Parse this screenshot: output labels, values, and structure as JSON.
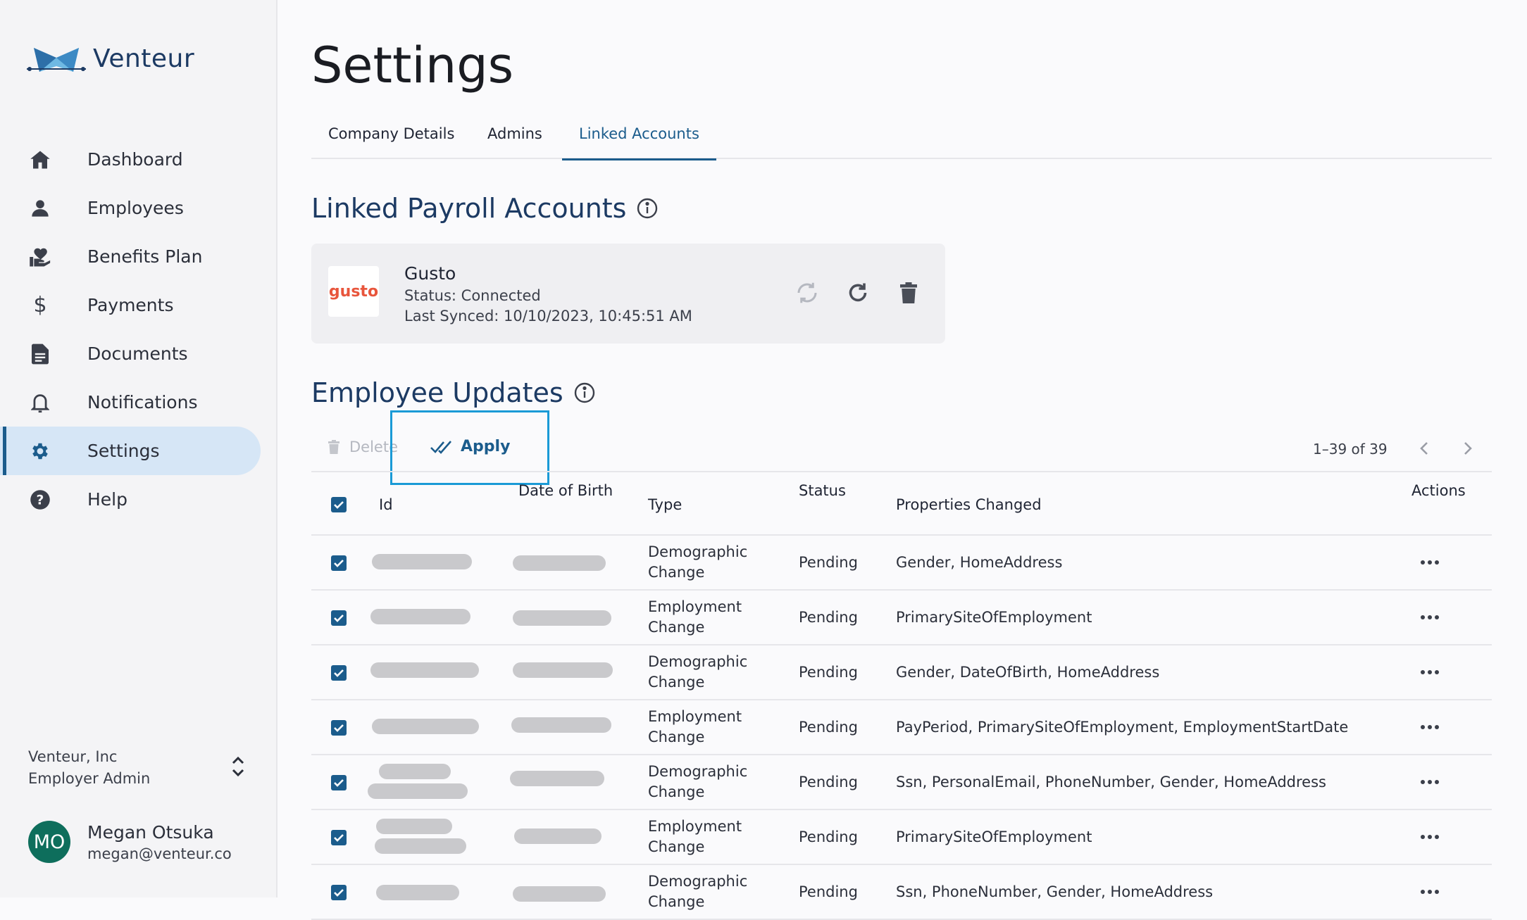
{
  "app": {
    "name": "Venteur"
  },
  "sidebar": {
    "items": [
      {
        "label": "Dashboard",
        "icon": "home-icon"
      },
      {
        "label": "Employees",
        "icon": "person-icon"
      },
      {
        "label": "Benefits Plan",
        "icon": "benefits-icon"
      },
      {
        "label": "Payments",
        "icon": "dollar-icon"
      },
      {
        "label": "Documents",
        "icon": "document-icon"
      },
      {
        "label": "Notifications",
        "icon": "bell-icon"
      },
      {
        "label": "Settings",
        "icon": "gear-icon",
        "active": true
      },
      {
        "label": "Help",
        "icon": "help-icon"
      }
    ],
    "org": {
      "name": "Venteur, Inc",
      "role": "Employer Admin"
    },
    "user": {
      "initials": "MO",
      "name": "Megan Otsuka",
      "email": "megan@venteur.co"
    }
  },
  "page": {
    "title": "Settings",
    "tabs": [
      {
        "label": "Company Details"
      },
      {
        "label": "Admins"
      },
      {
        "label": "Linked Accounts",
        "active": true
      }
    ]
  },
  "linked_payroll": {
    "title": "Linked Payroll Accounts",
    "account": {
      "logo_text": "gusto",
      "name": "Gusto",
      "status": "Status: Connected",
      "last_synced": "Last Synced: 10/10/2023, 10:45:51 AM"
    }
  },
  "employee_updates": {
    "title": "Employee Updates",
    "toolbar": {
      "delete_label": "Delete",
      "apply_label": "Apply"
    },
    "pagination": {
      "range": "1–39 of 39"
    },
    "columns": {
      "id": "Id",
      "dob": "Date of Birth",
      "type": "Type",
      "status": "Status",
      "props": "Properties Changed",
      "actions": "Actions"
    },
    "rows": [
      {
        "type1": "Demographic",
        "type2": "Change",
        "status": "Pending",
        "props": "Gender, HomeAddress"
      },
      {
        "type1": "Employment",
        "type2": "Change",
        "status": "Pending",
        "props": "PrimarySiteOfEmployment"
      },
      {
        "type1": "Demographic",
        "type2": "Change",
        "status": "Pending",
        "props": "Gender, DateOfBirth, HomeAddress"
      },
      {
        "type1": "Employment",
        "type2": "Change",
        "status": "Pending",
        "props": "PayPeriod, PrimarySiteOfEmployment, EmploymentStartDate"
      },
      {
        "type1": "Demographic",
        "type2": "Change",
        "status": "Pending",
        "props": "Ssn, PersonalEmail, PhoneNumber, Gender, HomeAddress"
      },
      {
        "type1": "Employment",
        "type2": "Change",
        "status": "Pending",
        "props": "PrimarySiteOfEmployment"
      },
      {
        "type1": "Demographic",
        "type2": "Change",
        "status": "Pending",
        "props": "Ssn, PhoneNumber, Gender, HomeAddress"
      }
    ]
  },
  "colors": {
    "accent": "#1b5c8c",
    "brand_navy": "#1c3a63",
    "highlight": "#1a9ad6",
    "gusto": "#e8553c",
    "avatar": "#0e6e5c"
  }
}
